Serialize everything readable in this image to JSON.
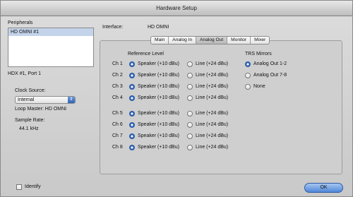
{
  "window": {
    "title": "Hardware Setup"
  },
  "sidebar": {
    "peripherals_label": "Peripherals",
    "peripherals": [
      "HD OMNI #1"
    ],
    "port_text": "HDX #1, Port 1",
    "clock_source_label": "Clock Source:",
    "clock_source_value": "Internal",
    "loop_master_text": "Loop Master: HD OMNI",
    "sample_rate_label": "Sample Rate:",
    "sample_rate_value": "44.1 kHz",
    "identify_label": "Identify"
  },
  "interface": {
    "label": "Interface:",
    "value": "HD OMNI"
  },
  "tabs": [
    "Main",
    "Analog In",
    "Analog Out",
    "Monitor",
    "Mixer"
  ],
  "active_tab": "Analog Out",
  "reference_level": {
    "heading": "Reference Level",
    "speaker_option": "Speaker (+10 dBu)",
    "line_option": "Line (+24 dBu)",
    "channels": [
      {
        "label": "Ch 1",
        "selected": "speaker"
      },
      {
        "label": "Ch 2",
        "selected": "speaker"
      },
      {
        "label": "Ch 3",
        "selected": "speaker"
      },
      {
        "label": "Ch 4",
        "selected": "speaker"
      },
      {
        "label": "Ch 5",
        "selected": "speaker"
      },
      {
        "label": "Ch 6",
        "selected": "speaker"
      },
      {
        "label": "Ch 7",
        "selected": "speaker"
      },
      {
        "label": "Ch 8",
        "selected": "speaker"
      }
    ]
  },
  "trs_mirrors": {
    "heading": "TRS Mirrors",
    "options": [
      "Analog Out 1-2",
      "Analog Out 7-8",
      "None"
    ],
    "selected": "Analog Out 1-2"
  },
  "buttons": {
    "ok_label": "OK"
  },
  "colors": {
    "accent": "#3a6fc4",
    "selection": "#c3d3ea"
  }
}
